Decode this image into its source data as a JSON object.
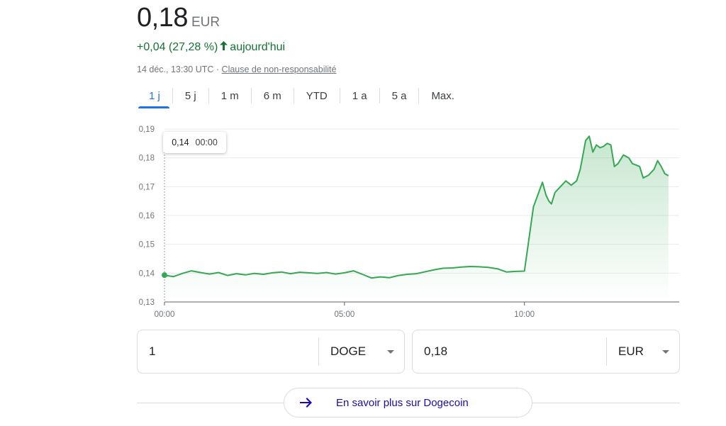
{
  "quote": {
    "price": "0,18",
    "currency": "EUR",
    "change": "+0,04 (27,28 %)",
    "period": "aujourd'hui",
    "timestamp": "14 déc., 13:30 UTC",
    "separator": "·",
    "disclaimer": "Clause de non-responsabilité"
  },
  "tabs": [
    {
      "label": "1 j",
      "active": true
    },
    {
      "label": "5 j"
    },
    {
      "label": "1 m"
    },
    {
      "label": "6 m"
    },
    {
      "label": "YTD"
    },
    {
      "label": "1 a"
    },
    {
      "label": "5 a"
    },
    {
      "label": "Max."
    }
  ],
  "tooltip": {
    "value": "0,14",
    "time": "00:00"
  },
  "colors": {
    "line": "#34a853",
    "positive": "#137333",
    "accent": "#1a73e8",
    "link": "#1a0dab"
  },
  "chart_data": {
    "type": "line",
    "y_ticks": [
      "0,19",
      "0,18",
      "0,17",
      "0,16",
      "0,15",
      "0,14",
      "0,13"
    ],
    "x_ticks": [
      "00:00",
      "05:00",
      "10:00"
    ],
    "ylim": [
      0.13,
      0.19
    ],
    "x_unit": "hours_utc",
    "xlim": [
      0,
      14.3
    ],
    "x": [
      0,
      0.25,
      0.5,
      0.75,
      1.0,
      1.25,
      1.5,
      1.75,
      2.0,
      2.25,
      2.5,
      2.75,
      3.0,
      3.25,
      3.5,
      3.75,
      4.0,
      4.25,
      4.5,
      4.75,
      5.0,
      5.25,
      5.5,
      5.75,
      6.0,
      6.25,
      6.5,
      6.75,
      7.0,
      7.25,
      7.5,
      7.75,
      8.0,
      8.25,
      8.5,
      8.75,
      9.0,
      9.25,
      9.5,
      9.75,
      10.0,
      10.25,
      10.5,
      10.6,
      10.68,
      10.75,
      10.85,
      11.0,
      11.15,
      11.3,
      11.45,
      11.55,
      11.7,
      11.8,
      11.9,
      12.0,
      12.1,
      12.2,
      12.3,
      12.4,
      12.5,
      12.6,
      12.75,
      12.9,
      13.0,
      13.1,
      13.2,
      13.3,
      13.45,
      13.6,
      13.7,
      13.8,
      13.9,
      14.0
    ],
    "y": [
      0.1393,
      0.1388,
      0.1399,
      0.1408,
      0.1402,
      0.1397,
      0.1402,
      0.1392,
      0.1398,
      0.1394,
      0.1399,
      0.1396,
      0.1401,
      0.1404,
      0.1398,
      0.1403,
      0.1401,
      0.1399,
      0.1402,
      0.1397,
      0.1401,
      0.1408,
      0.1396,
      0.1383,
      0.1387,
      0.1384,
      0.1392,
      0.1396,
      0.1398,
      0.1405,
      0.1412,
      0.1417,
      0.1418,
      0.1421,
      0.1423,
      0.1422,
      0.142,
      0.1415,
      0.1404,
      0.1406,
      0.1407,
      0.163,
      0.1715,
      0.167,
      0.165,
      0.164,
      0.168,
      0.17,
      0.172,
      0.1705,
      0.172,
      0.176,
      0.186,
      0.1875,
      0.182,
      0.1845,
      0.1835,
      0.184,
      0.185,
      0.1845,
      0.177,
      0.178,
      0.181,
      0.18,
      0.178,
      0.1775,
      0.177,
      0.173,
      0.174,
      0.176,
      0.179,
      0.177,
      0.1745,
      0.1738
    ]
  },
  "converter": {
    "from_amount": "1",
    "from_unit": "DOGE",
    "to_amount": "0,18",
    "to_unit": "EUR"
  },
  "learn_more": {
    "label": "En savoir plus sur Dogecoin",
    "icon": "arrow-right-icon"
  }
}
